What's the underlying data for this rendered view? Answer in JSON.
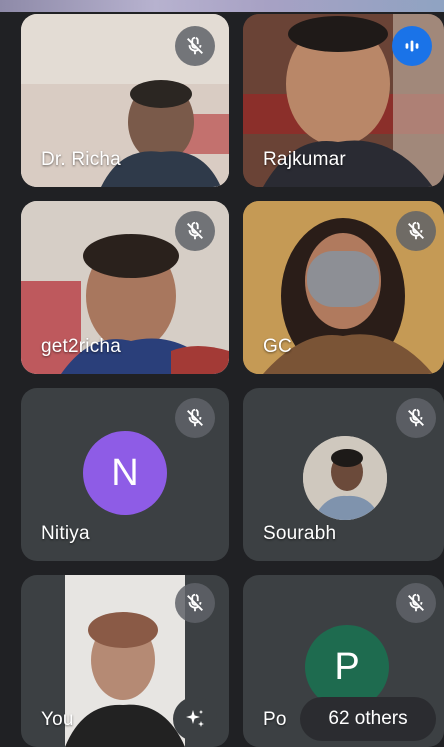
{
  "participants": [
    {
      "name": "Dr. Richa",
      "muted": true
    },
    {
      "name": "Rajkumar",
      "muted": false,
      "speaking": true
    },
    {
      "name": "get2richa",
      "muted": true
    },
    {
      "name": "GC",
      "muted": true
    },
    {
      "name": "Nitiya",
      "muted": true,
      "avatar_letter": "N",
      "avatar_color": "#8e5ce6"
    },
    {
      "name": "Sourabh",
      "muted": true
    },
    {
      "name": "You",
      "muted": true
    },
    {
      "name": "Po",
      "muted": true,
      "avatar_letter": "P",
      "avatar_color": "#1e6b4f"
    }
  ],
  "others_label": "62 others",
  "icons": {
    "mute": "mic-off-icon",
    "speaking": "audio-levels-icon",
    "effects": "sparkle-icon"
  },
  "colors": {
    "background": "#202124",
    "tile": "#3c4043",
    "speaking_accent": "#1a73e8"
  }
}
